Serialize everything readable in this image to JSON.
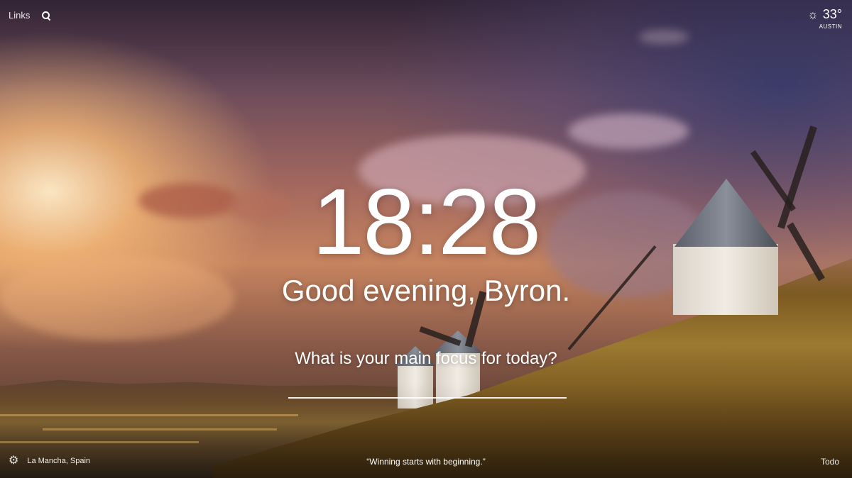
{
  "top_left": {
    "links_label": "Links",
    "search_icon": "search-icon"
  },
  "weather": {
    "icon": "sun-icon",
    "temperature": "33°",
    "location": "AUSTIN"
  },
  "clock": {
    "time": "18:28"
  },
  "greeting": {
    "text": "Good evening, Byron."
  },
  "focus": {
    "question": "What is your main focus for today?",
    "input_value": ""
  },
  "bottom": {
    "settings_icon": "gear-icon",
    "photo_location": "La Mancha, Spain",
    "quote": "“Winning starts with beginning.”",
    "todo_label": "Todo"
  }
}
